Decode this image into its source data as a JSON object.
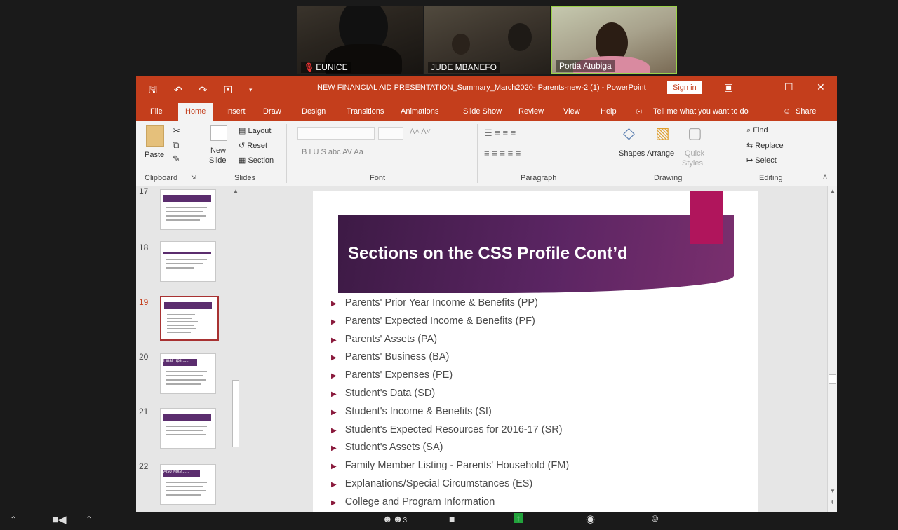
{
  "participants": [
    {
      "name": "EUNICE",
      "muted": true
    },
    {
      "name": "JUDE MBANEFO",
      "muted": false
    },
    {
      "name": "Portia Atubiga",
      "muted": false
    }
  ],
  "powerpoint": {
    "title": "NEW FINANCIAL AID PRESENTATION_Summary_March2020- Parents-new-2 (1)  -  PowerPoint",
    "signin": "Sign in",
    "tabs": [
      "File",
      "Home",
      "Insert",
      "Draw",
      "Design",
      "Transitions",
      "Animations",
      "Slide Show",
      "Review",
      "View",
      "Help"
    ],
    "tellme": "Tell me what you want to do",
    "share": "Share",
    "ribbon": {
      "clipboard": {
        "label": "Clipboard",
        "paste": "Paste"
      },
      "slides": {
        "label": "Slides",
        "new_slide": "New",
        "new_slide2": "Slide",
        "layout": "Layout",
        "reset": "Reset",
        "section": "Section"
      },
      "font": {
        "label": "Font",
        "buttons": "B   I   U   S   abc   AV  Aa"
      },
      "paragraph": {
        "label": "Paragraph"
      },
      "drawing": {
        "label": "Drawing",
        "shapes": "Shapes",
        "arrange": "Arrange",
        "quick_styles": "Quick",
        "quick_styles2": "Styles"
      },
      "editing": {
        "label": "Editing",
        "find": "Find",
        "replace": "Replace",
        "select": "Select"
      }
    },
    "thumbnails": [
      "17",
      "18",
      "19",
      "20",
      "21",
      "22"
    ],
    "selected_slide": "19",
    "thumb_titles": {
      "20": "Final Tips......",
      "22": "Also Note......"
    },
    "slide": {
      "title": "Sections on the CSS Profile Cont’d",
      "bullets": [
        "Parents' Prior Year Income & Benefits (PP)",
        "Parents' Expected Income & Benefits (PF)",
        "Parents' Assets (PA)",
        "Parents' Business (BA)",
        "Parents' Expenses (PE)",
        "Student's Data (SD)",
        "Student's Income & Benefits (SI)",
        "Student's Expected Resources for 2016-17 (SR)",
        "Student's Assets (SA)",
        "Family Member Listing - Parents' Household (FM)",
        "Explanations/Special Circumstances (ES)",
        "College and Program Information"
      ]
    }
  },
  "zoom": {
    "participant_count": "3"
  },
  "colors": {
    "ppt_red": "#c43e1c",
    "banner": "#5b2563",
    "accent": "#b0155c"
  }
}
